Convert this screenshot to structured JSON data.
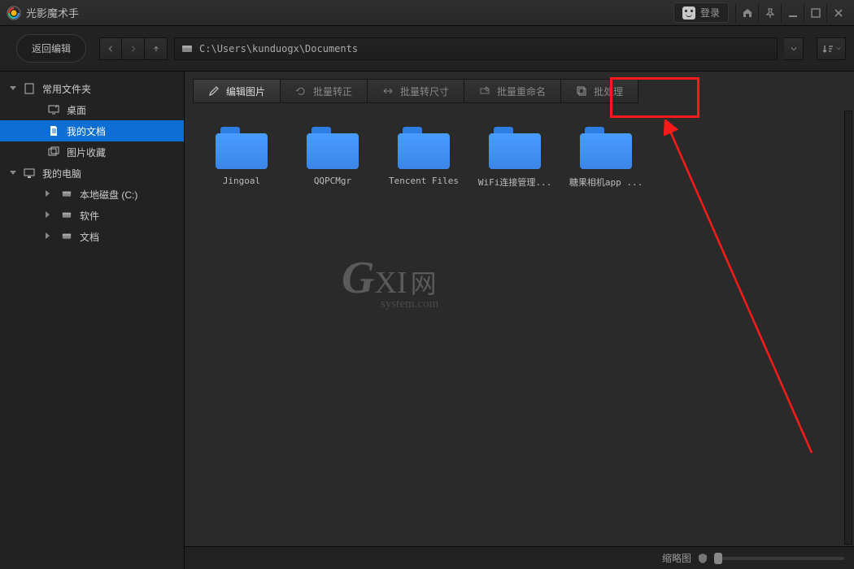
{
  "app": {
    "title": "光影魔术手"
  },
  "titlebar": {
    "login_label": "登录"
  },
  "toolbar": {
    "back_edit": "返回编辑",
    "path": "C:\\Users\\kunduogx\\Documents"
  },
  "sidebar": {
    "items": [
      {
        "label": "常用文件夹",
        "icon": "sheet"
      },
      {
        "label": "桌面",
        "icon": "desktop"
      },
      {
        "label": "我的文档",
        "icon": "doc"
      },
      {
        "label": "图片收藏",
        "icon": "images"
      },
      {
        "label": "我的电脑",
        "icon": "pc"
      },
      {
        "label": "本地磁盘 (C:)",
        "icon": "disk"
      },
      {
        "label": "软件",
        "icon": "disk"
      },
      {
        "label": "文档",
        "icon": "disk"
      }
    ]
  },
  "actions": {
    "edit_image": "编辑图片",
    "batch_rotate": "批量转正",
    "batch_resize": "批量转尺寸",
    "batch_rename": "批量重命名",
    "batch_process": "批处理"
  },
  "folders": [
    {
      "name": "Jingoal"
    },
    {
      "name": "QQPCMgr"
    },
    {
      "name": "Tencent Files"
    },
    {
      "name": "WiFi连接管理..."
    },
    {
      "name": "糖果相机app ..."
    }
  ],
  "watermark": {
    "main_g": "G",
    "main_xi": "XI",
    "main_wang": "网",
    "sub": "system.com"
  },
  "statusbar": {
    "thumbnail_label": "缩略图"
  },
  "annotation": {
    "highlight_target": "batch_process"
  }
}
